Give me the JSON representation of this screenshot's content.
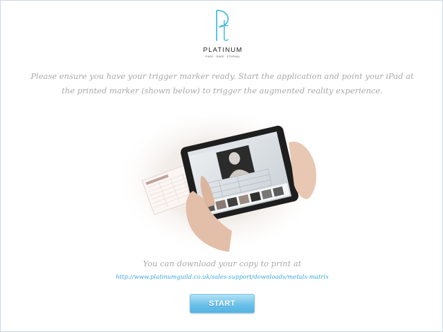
{
  "logo": {
    "wordmark": "PLATINUM",
    "tagline": "PURE · RARE · ETERNAL"
  },
  "instructions": "Please ensure you have your trigger marker ready. Start the application and point your iPad at the printed marker (shown below) to trigger the augmented reality experience.",
  "download": {
    "text": "You can download your copy to print at",
    "link": "http://www.platinumguild.co.uk/sales-support/downloads/metals-matrix"
  },
  "start_button": {
    "label": "START"
  },
  "colors": {
    "brand_teal": "#2fb6e0",
    "link": "#39a6dc",
    "instruction_text": "#a9a9a9",
    "button": "#6cc1ea"
  }
}
